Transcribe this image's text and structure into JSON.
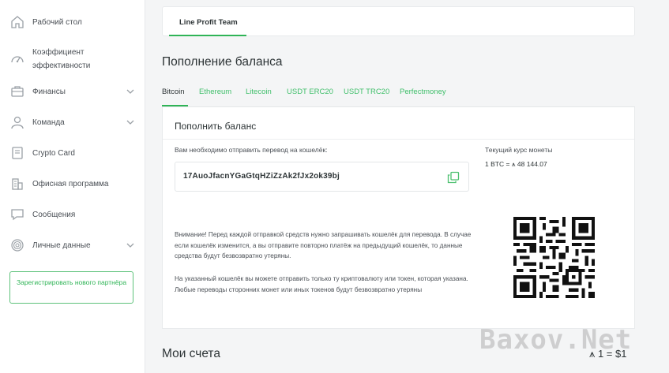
{
  "sidebar": {
    "items": [
      {
        "label": "Рабочий стол",
        "icon": "home-icon",
        "expandable": false
      },
      {
        "label": "Коэффициент эффективности",
        "icon": "speedometer-icon",
        "expandable": false
      },
      {
        "label": "Финансы",
        "icon": "wallet-icon",
        "expandable": true
      },
      {
        "label": "Команда",
        "icon": "user-icon",
        "expandable": true
      },
      {
        "label": "Crypto Card",
        "icon": "card-icon",
        "expandable": false
      },
      {
        "label": "Офисная программа",
        "icon": "office-building-icon",
        "expandable": false
      },
      {
        "label": "Сообщения",
        "icon": "chat-icon",
        "expandable": false
      },
      {
        "label": "Личные данные",
        "icon": "fingerprint-icon",
        "expandable": true
      }
    ],
    "register_button": "Зарегистрировать нового партнёра"
  },
  "header": {
    "team_tab": "Line Profit Team"
  },
  "balance": {
    "title": "Пополнение баланса",
    "tabs": [
      "Bitcoin",
      "Ethereum",
      "Litecoin",
      "USDT ERC20",
      "USDT TRC20",
      "Perfectmoney"
    ],
    "active_tab": "Bitcoin"
  },
  "card": {
    "title": "Пополнить баланс",
    "hint": "Вам необходимо отправить перевод на кошелёк:",
    "wallet": "17AuoJfacnYGaGtqHZiZzAk2fJx2ok39bj",
    "rate_label": "Текущий курс монеты",
    "rate_value": "1 BTC = ⩚ 48 144.07",
    "warning1": "Внимание! Перед каждой отправкой средств нужно запрашивать кошелёк для перевода. В случае если кошелёк изменится, а вы отправите повторно платёж на предыдущий кошелёк, то данные средства будут безвозвратно утеряны.",
    "warning2": "На указанный кошелёк вы можете отправить только ту криптовалюту или токен, которая указана. Любые переводы сторонних монет или иных токенов будут безвозвратно утеряны"
  },
  "accounts": {
    "title": "Мои счета",
    "rate": "⩚ 1 = $1"
  },
  "watermark": "Baxov.Net",
  "colors": {
    "accent": "#2fb456",
    "text": "#2d3436",
    "background": "#f4f5f6"
  }
}
